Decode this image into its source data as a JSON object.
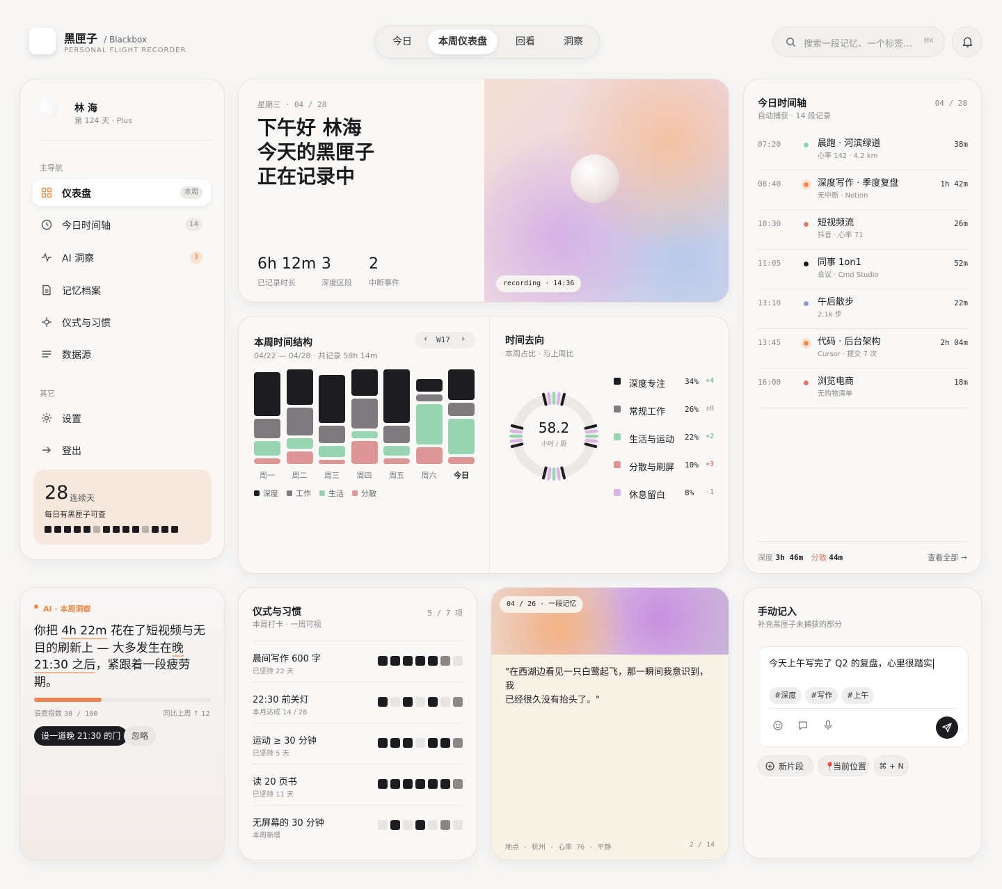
{
  "app": {
    "name": "黑匣子",
    "name_suffix": "/ Blackbox",
    "tagline": "PERSONAL FLIGHT RECORDER"
  },
  "tabs": [
    {
      "label": "今日",
      "active": false
    },
    {
      "label": "本周仪表盘",
      "active": true
    },
    {
      "label": "回看",
      "active": false
    },
    {
      "label": "洞察",
      "active": false
    }
  ],
  "search": {
    "placeholder": "搜索一段记忆、一个标签…",
    "shortcut": "⌘K"
  },
  "user": {
    "name": "林 海",
    "meta": "第 124 天 · Plus"
  },
  "sidebar": {
    "section_main": "主导航",
    "items": [
      {
        "label": "仪表盘",
        "badge": "本周",
        "icon": "grid-icon",
        "active": true
      },
      {
        "label": "今日时间轴",
        "badge": "14",
        "icon": "clock-icon",
        "active": false
      },
      {
        "label": "AI 洞察",
        "badge": "3",
        "icon": "pulse-icon",
        "active": false
      },
      {
        "label": "记忆档案",
        "badge": "",
        "icon": "document-icon",
        "active": false
      },
      {
        "label": "仪式与习惯",
        "badge": "",
        "icon": "sparkle-icon",
        "active": false
      },
      {
        "label": "数据源",
        "badge": "",
        "icon": "list-icon",
        "active": false
      }
    ],
    "section_other": "其它",
    "other_items": [
      {
        "label": "设置",
        "icon": "gear-icon"
      },
      {
        "label": "登出",
        "icon": "arrow-right-icon"
      }
    ],
    "streak": {
      "days": "28",
      "unit": "连续天",
      "caption": "每日有黑匣子可查",
      "days_pattern": [
        1,
        1,
        1,
        1,
        1,
        0,
        1,
        1,
        1,
        1,
        0,
        1,
        1,
        1
      ]
    }
  },
  "hero": {
    "date": "星期三 · 04 / 28",
    "headline": [
      "下午好 林海",
      "今天的黑匣子",
      "正在记录中"
    ],
    "stats": [
      {
        "value": "6h 12m",
        "label": "已记录时长"
      },
      {
        "value": "3",
        "label": "深度区段"
      },
      {
        "value": "2",
        "label": "中断事件"
      }
    ],
    "recording": "recording · 14:36"
  },
  "timeline": {
    "title": "今日时间轴",
    "date": "04 / 28",
    "subtitle": "自动捕获 · 14 段记录",
    "entries": [
      {
        "time": "07:20",
        "title": "晨跑 · 河滨绿道",
        "sub": "心率 142 · 4.2 km",
        "dur": "38m",
        "color": "#8fd0a8"
      },
      {
        "time": "08:40",
        "title": "深度写作 · 季度复盘",
        "sub": "无中断 · Notion",
        "dur": "1h 42m",
        "color": "#f08a4b"
      },
      {
        "time": "10:30",
        "title": "短视频流",
        "sub": "抖音 · 心率 71",
        "dur": "26m",
        "color": "#e07a6a"
      },
      {
        "time": "11:05",
        "title": "同事 1on1",
        "sub": "会议 · Cmd Studio",
        "dur": "52m",
        "color": "#1a1a1d"
      },
      {
        "time": "13:10",
        "title": "午后散步",
        "sub": "2.1k 步",
        "dur": "22m",
        "color": "#8a9ad8"
      },
      {
        "time": "13:45",
        "title": "代码 · 后台架构",
        "sub": "Cursor · 提交 7 次",
        "dur": "2h 04m",
        "color": "#f08a4b"
      },
      {
        "time": "16:00",
        "title": "浏览电商",
        "sub": "无购物清单",
        "dur": "18m",
        "color": "#e07a6a"
      }
    ],
    "footer": {
      "deep_label": "深度",
      "deep_value": "3h 46m",
      "scatter_label": "分散",
      "scatter_value": "44m",
      "link": "查看全部 →"
    }
  },
  "week": {
    "title": "本周时间结构",
    "subtitle": "04/22 — 04/28 · 共记录 58h 14m",
    "week_label": "W17",
    "legend": [
      "深度",
      "工作",
      "生活",
      "分散"
    ],
    "colors": {
      "deep": "#1d1c20",
      "work": "#7d7b7d",
      "life": "#97d4b1",
      "scatter": "#dd9595"
    }
  },
  "chart_data": {
    "type": "bar",
    "title": "本周时间结构",
    "categories": [
      "周一",
      "周二",
      "周三",
      "周四",
      "周五",
      "周六",
      "今日"
    ],
    "series": [
      {
        "name": "深度",
        "values": [
          62,
          50,
          68,
          38,
          76,
          18,
          44
        ]
      },
      {
        "name": "工作",
        "values": [
          28,
          40,
          24,
          42,
          24,
          10,
          18
        ]
      },
      {
        "name": "生活",
        "values": [
          20,
          14,
          16,
          10,
          14,
          56,
          50
        ]
      },
      {
        "name": "分散",
        "values": [
          8,
          18,
          6,
          32,
          8,
          24,
          10
        ]
      }
    ]
  },
  "direction": {
    "title": "时间去向",
    "subtitle": "本周占比 · 与上周比",
    "center_value": "58.2",
    "center_unit": "小时 / 周",
    "items": [
      {
        "name": "深度专注",
        "pct": "34%",
        "diff": "+4",
        "color": "#1d1c20",
        "diff_color": "#5aa87a"
      },
      {
        "name": "常规工作",
        "pct": "26%",
        "diff": "±0",
        "color": "#7d7b7d",
        "diff_color": "#8c8a88"
      },
      {
        "name": "生活与运动",
        "pct": "22%",
        "diff": "+2",
        "color": "#97d4b1",
        "diff_color": "#5aa87a"
      },
      {
        "name": "分散与刷屏",
        "pct": "10%",
        "diff": "+3",
        "color": "#dd9595",
        "diff_color": "#d0604a"
      },
      {
        "name": "休息留白",
        "pct": "8%",
        "diff": "-1",
        "color": "#d9b3e6",
        "diff_color": "#8c8a88"
      }
    ]
  },
  "insight": {
    "tag": "AI · 本周洞察",
    "text": [
      "你把 ",
      "4h 22m",
      " 花在了短视频与无目的刷新上 — 大多发生在",
      "晚 21:30 之后",
      "，紧跟着一段疲劳期。"
    ],
    "index_label": "浪费指数",
    "index_value": "38 / 100",
    "index_fraction": 0.38,
    "compare": "同比上周 ↑ 12",
    "primary": "设一道晚 21:30 的门",
    "secondary": "忽略"
  },
  "rituals": {
    "title": "仪式与习惯",
    "count": "5 / 7 项",
    "subtitle": "本周打卡 · 一周可视",
    "items": [
      {
        "name": "晨间写作 600 字",
        "sub": "已坚持 22 天",
        "days": [
          2,
          2,
          2,
          2,
          2,
          1,
          0
        ]
      },
      {
        "name": "22:30 前关灯",
        "sub": "本月达成 14 / 28",
        "days": [
          2,
          0,
          2,
          0,
          2,
          0,
          1
        ]
      },
      {
        "name": "运动 ≥ 30 分钟",
        "sub": "已坚持 5 天",
        "days": [
          2,
          2,
          2,
          0,
          2,
          2,
          1
        ]
      },
      {
        "name": "读 20 页书",
        "sub": "已坚持 11 天",
        "days": [
          2,
          2,
          2,
          2,
          2,
          2,
          1
        ]
      },
      {
        "name": "无屏幕的 30 分钟",
        "sub": "本周新增",
        "days": [
          0,
          2,
          0,
          2,
          0,
          1,
          0
        ]
      }
    ]
  },
  "memory": {
    "date": "04 / 26 · 一段记忆",
    "quote": [
      "\"在西湖边看见一只白鹭起飞，那一瞬间我意识到，",
      "我",
      "已经很久没有抬头了。\""
    ],
    "meta": "地点 · 杭州 · 心率 76 · 平静",
    "page": "2 / 14"
  },
  "manual": {
    "title": "手动记入",
    "subtitle": "补充黑匣子未捕获的部分",
    "text": "今天上午写完了 Q2 的复盘，心里很踏实",
    "tags": [
      "#深度",
      "#写作",
      "#上午"
    ],
    "actions": [
      {
        "label": "新片段",
        "icon": "plus-circle-icon"
      },
      {
        "label": "当前位置",
        "icon": "pin-icon"
      },
      {
        "label": "⌘ + N",
        "icon": ""
      }
    ]
  }
}
